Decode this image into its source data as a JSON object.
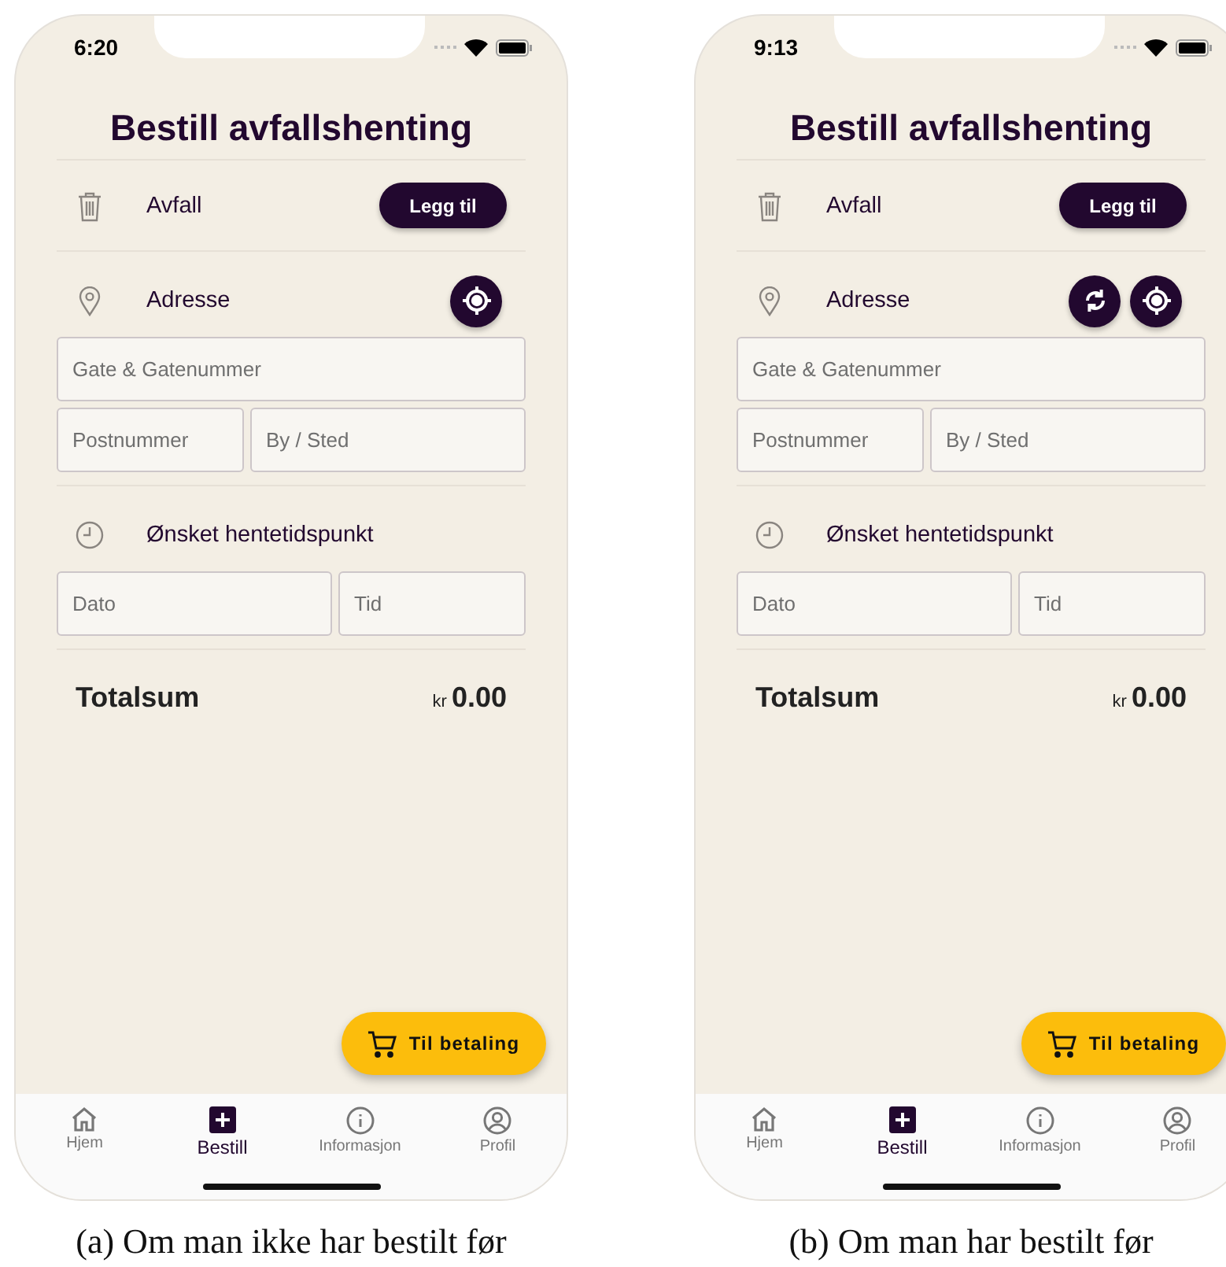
{
  "screens": [
    {
      "status_time": "6:20",
      "title": "Bestill avfallshenting",
      "sections": [
        {
          "kind": "waste",
          "label": "Avfall",
          "button": "Legg til"
        },
        {
          "kind": "address",
          "label": "Adresse",
          "actions": [
            {
              "kind": "locate"
            }
          ],
          "field_rows": [
            [
              {
                "placeholder": "Gate & Gatenummer"
              }
            ],
            [
              {
                "placeholder": "Postnummer"
              },
              {
                "placeholder": "By / Sted"
              }
            ]
          ]
        },
        {
          "kind": "time",
          "label": "Ønsket hentetidspunkt",
          "field_rows": [
            [
              {
                "placeholder": "Dato"
              },
              {
                "placeholder": "Tid"
              }
            ]
          ]
        }
      ],
      "total": {
        "label": "Totalsum",
        "currency": "kr",
        "amount": "0.00"
      },
      "checkout_button": "Til betaling",
      "nav": [
        {
          "kind": "home",
          "label": "Hjem",
          "selected": false
        },
        {
          "kind": "order",
          "label": "Bestill",
          "selected": true
        },
        {
          "kind": "info",
          "label": "Informasjon",
          "selected": false
        },
        {
          "kind": "profile",
          "label": "Profil",
          "selected": false
        }
      ],
      "caption": "(a) Om man ikke har bestilt før"
    },
    {
      "status_time": "9:13",
      "title": "Bestill avfallshenting",
      "sections": [
        {
          "kind": "waste",
          "label": "Avfall",
          "button": "Legg til"
        },
        {
          "kind": "address",
          "label": "Adresse",
          "actions": [
            {
              "kind": "refresh"
            },
            {
              "kind": "locate"
            }
          ],
          "field_rows": [
            [
              {
                "placeholder": "Gate & Gatenummer"
              }
            ],
            [
              {
                "placeholder": "Postnummer"
              },
              {
                "placeholder": "By / Sted"
              }
            ]
          ]
        },
        {
          "kind": "time",
          "label": "Ønsket hentetidspunkt",
          "field_rows": [
            [
              {
                "placeholder": "Dato"
              },
              {
                "placeholder": "Tid"
              }
            ]
          ]
        }
      ],
      "total": {
        "label": "Totalsum",
        "currency": "kr",
        "amount": "0.00"
      },
      "checkout_button": "Til betaling",
      "nav": [
        {
          "kind": "home",
          "label": "Hjem",
          "selected": false
        },
        {
          "kind": "order",
          "label": "Bestill",
          "selected": true
        },
        {
          "kind": "info",
          "label": "Informasjon",
          "selected": false
        },
        {
          "kind": "profile",
          "label": "Profil",
          "selected": false
        }
      ],
      "caption": "(b) Om man har bestilt før"
    }
  ]
}
